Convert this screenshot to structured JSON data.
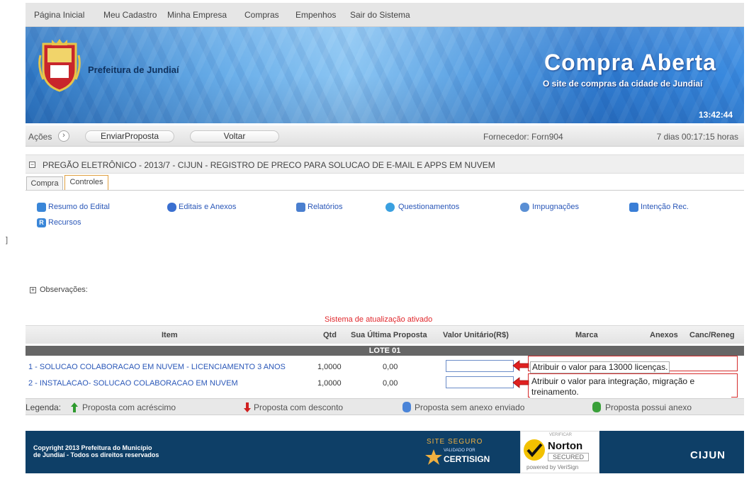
{
  "nav": {
    "items": [
      "Página Inicial",
      "Meu Cadastro",
      "Minha Empresa",
      "Compras",
      "Empenhos",
      "Sair do Sistema"
    ]
  },
  "banner": {
    "prefeitura": "Prefeitura de Jundiaí",
    "brand": "Compra Aberta",
    "tagline": "O site de compras da cidade de Jundiaí",
    "clock": "13:42:44"
  },
  "actions": {
    "label": "Ações",
    "enviar": "EnviarProposta",
    "voltar": "Voltar",
    "fornecedor": "Fornecedor: Forn904",
    "timer": "7 dias 00:17:15 horas"
  },
  "process": {
    "title": "PREGÃO ELETRÔNICO - 2013/7 - CIJUN - REGISTRO DE PRECO PARA SOLUCAO DE E-MAIL E APPS EM NUVEM"
  },
  "tabs": [
    "Compra",
    "Controles"
  ],
  "links": [
    "Resumo do Edital",
    "Editais e Anexos",
    "Relatórios",
    "Questionamentos",
    "Impugnações",
    "Intenção Rec.",
    "Recursos"
  ],
  "obs": {
    "label": "Observações:"
  },
  "sistema": "Sistema de atualização ativado",
  "table": {
    "headers": [
      "Item",
      "Qtd",
      "Sua Última Proposta",
      "Valor Unitário(R$)",
      "Marca",
      "Anexos",
      "Canc/Reneg"
    ],
    "lote": "LOTE 01",
    "rows": [
      {
        "item": "1 - SOLUCAO COLABORACAO EM NUVEM - LICENCIAMENTO 3 ANOS",
        "qtd": "1,0000",
        "ultima": "0,00",
        "valor": ""
      },
      {
        "item": "2 - INSTALACAO- SOLUCAO COLABORACAO EM NUVEM",
        "qtd": "1,0000",
        "ultima": "0,00",
        "valor": ""
      }
    ]
  },
  "annotations": [
    "Atribuir o valor para 13000 licenças.",
    "Atribuir o valor para integração, migração e treinamento."
  ],
  "legend": {
    "title": "Legenda:",
    "items": [
      "Proposta com acréscimo",
      "Proposta com desconto",
      "Proposta sem anexo enviado",
      "Proposta possui anexo"
    ]
  },
  "footer": {
    "copyright_1": "Copyright 2013 Prefeitura do Município",
    "copyright_2": "de Jundiaí - Todos os direitos reservados",
    "certisign_top": "SITE SEGURO",
    "certisign_mid": "VALIDADO POR",
    "certisign_name": "CERTISIGN",
    "norton_top": "VERIFICAR",
    "norton_name": "Norton",
    "norton_secured": "SECURED",
    "norton_powered": "powered by VeriSign",
    "cijun": "CIJUN"
  },
  "colors": {
    "annotation": "#d62c2c",
    "lote_bar": "#666666",
    "footer": "#0e3f67",
    "link": "#2a57b8"
  }
}
